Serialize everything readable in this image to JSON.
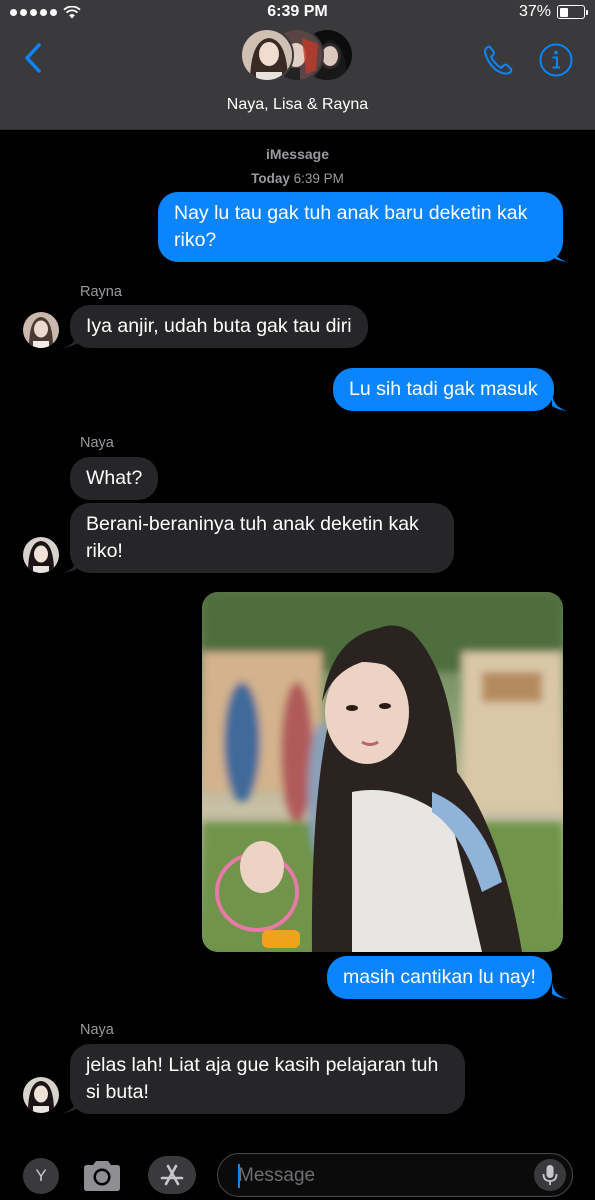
{
  "status_bar": {
    "time": "6:39 PM",
    "battery": "37%",
    "battery_level": 0.37
  },
  "header": {
    "group_name": "Naya, Lisa & Rayna"
  },
  "conversation": {
    "service": "iMessage",
    "date_label": "Today",
    "time_label": "6:39 PM",
    "messages": [
      {
        "from": "me",
        "text": "Nay lu tau gak tuh anak baru deketin kak riko?"
      },
      {
        "sender": "Rayna",
        "text": "Iya anjir, udah buta gak tau diri"
      },
      {
        "from": "me",
        "text": "Lu sih tadi gak masuk"
      },
      {
        "sender": "Naya",
        "text": "What?"
      },
      {
        "text": "Berani-beraninya tuh anak deketin kak riko!"
      },
      {
        "from": "me",
        "type": "photo"
      },
      {
        "from": "me",
        "text": "masih cantikan lu nay!"
      },
      {
        "sender": "Naya",
        "text": "jelas lah! Liat aja gue kasih pelajaran tuh si buta!"
      }
    ]
  },
  "compose": {
    "app_y_label": "Y",
    "placeholder": "Message"
  },
  "icons": {
    "back": "chevron-left-icon",
    "phone": "phone-icon",
    "info": "info-icon",
    "camera": "camera-icon",
    "app_store": "app-store-icon",
    "mic": "microphone-icon"
  },
  "colors": {
    "accent": "#0a84ff",
    "sent_bubble": "#0a84ff",
    "received_bubble": "#262628",
    "header_bg": "#3a3a3c",
    "background": "#000000"
  }
}
